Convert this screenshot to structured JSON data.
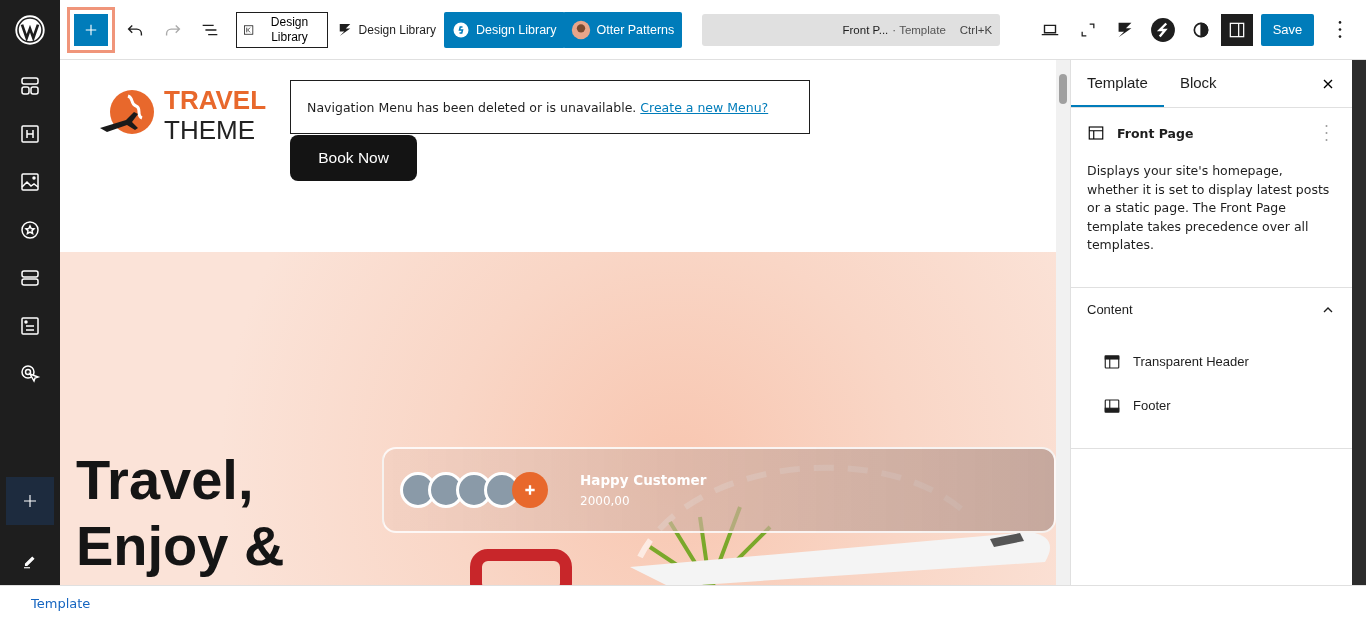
{
  "toolbar": {
    "design_library_boxed": "Design Library",
    "design_library_plain": "Design Library",
    "design_library_button": "Design Library",
    "otter_button": "Otter Patterns",
    "command": {
      "title": "Front P...",
      "type": "· Template",
      "shortcut": "Ctrl+K"
    },
    "save": "Save"
  },
  "canvas": {
    "logo": {
      "line_1": "TRAVEL",
      "line_2": "THEME"
    },
    "nav_notice": {
      "text": "Navigation Menu has been deleted or is unavailable.",
      "link": "Create a new Menu?"
    },
    "cta": "Book Now",
    "hero": {
      "heading": [
        "Travel,",
        "Enjoy &"
      ],
      "customers": {
        "title": "Happy Customer",
        "count": "2000,00"
      }
    }
  },
  "panel": {
    "tabs": [
      {
        "label": "Template",
        "selected": true
      },
      {
        "label": "Block",
        "selected": false
      }
    ],
    "template_name": "Front Page",
    "description": "Displays your site's homepage, whether it is set to display latest posts or a static page. The Front Page template takes precedence over all templates.",
    "content": {
      "title": "Content",
      "expanded": true,
      "items": [
        {
          "label": "Transparent Header",
          "kind": "header"
        },
        {
          "label": "Footer",
          "kind": "footer"
        }
      ]
    }
  },
  "status_bar": {
    "breadcrumb": "Template"
  }
}
